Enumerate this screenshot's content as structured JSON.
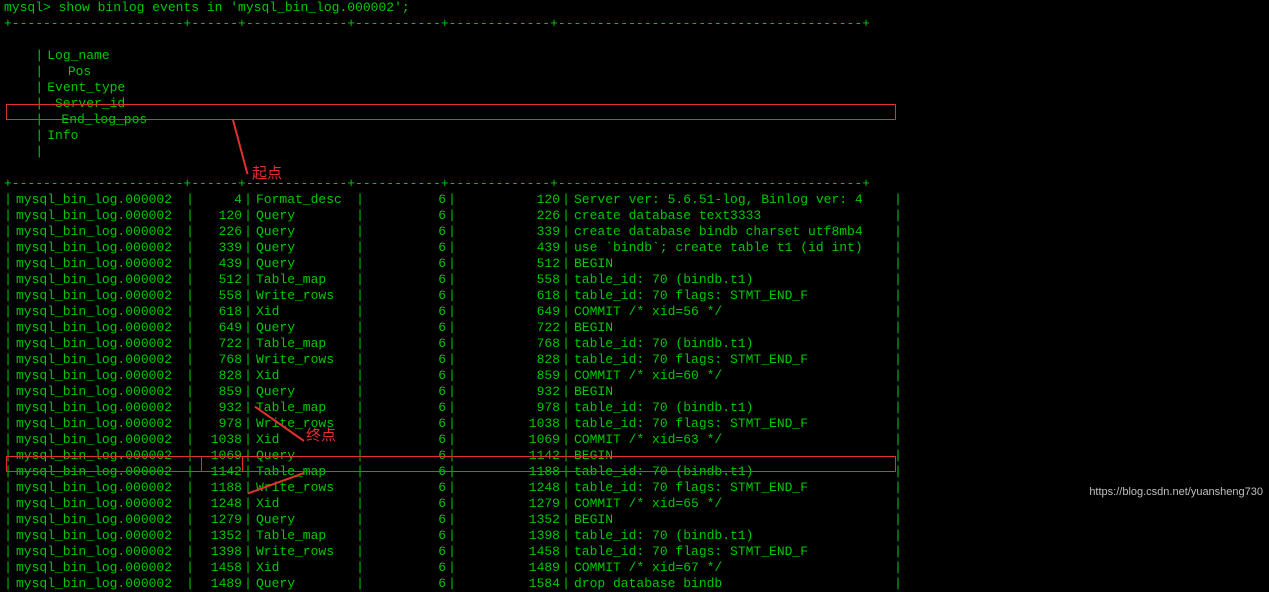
{
  "prompt": "mysql> show binlog events in 'mysql_bin_log.000002';",
  "headers": {
    "log_name": "Log_name",
    "pos": "Pos",
    "event_type": "Event_type",
    "server_id": "Server_id",
    "end_log_pos": "End_log_pos",
    "info": "Info"
  },
  "rows": [
    {
      "log": "mysql_bin_log.000002",
      "pos": "4",
      "evt": "Format_desc",
      "srv": "6",
      "end": "120",
      "info": "Server ver: 5.6.51-log, Binlog ver: 4"
    },
    {
      "log": "mysql_bin_log.000002",
      "pos": "120",
      "evt": "Query",
      "srv": "6",
      "end": "226",
      "info": "create database text3333"
    },
    {
      "log": "mysql_bin_log.000002",
      "pos": "226",
      "evt": "Query",
      "srv": "6",
      "end": "339",
      "info": "create database bindb charset utf8mb4"
    },
    {
      "log": "mysql_bin_log.000002",
      "pos": "339",
      "evt": "Query",
      "srv": "6",
      "end": "439",
      "info": "use `bindb`; create table t1 (id int)"
    },
    {
      "log": "mysql_bin_log.000002",
      "pos": "439",
      "evt": "Query",
      "srv": "6",
      "end": "512",
      "info": "BEGIN"
    },
    {
      "log": "mysql_bin_log.000002",
      "pos": "512",
      "evt": "Table_map",
      "srv": "6",
      "end": "558",
      "info": "table_id: 70 (bindb.t1)"
    },
    {
      "log": "mysql_bin_log.000002",
      "pos": "558",
      "evt": "Write_rows",
      "srv": "6",
      "end": "618",
      "info": "table_id: 70 flags: STMT_END_F"
    },
    {
      "log": "mysql_bin_log.000002",
      "pos": "618",
      "evt": "Xid",
      "srv": "6",
      "end": "649",
      "info": "COMMIT /* xid=56 */"
    },
    {
      "log": "mysql_bin_log.000002",
      "pos": "649",
      "evt": "Query",
      "srv": "6",
      "end": "722",
      "info": "BEGIN"
    },
    {
      "log": "mysql_bin_log.000002",
      "pos": "722",
      "evt": "Table_map",
      "srv": "6",
      "end": "768",
      "info": "table_id: 70 (bindb.t1)"
    },
    {
      "log": "mysql_bin_log.000002",
      "pos": "768",
      "evt": "Write_rows",
      "srv": "6",
      "end": "828",
      "info": "table_id: 70 flags: STMT_END_F"
    },
    {
      "log": "mysql_bin_log.000002",
      "pos": "828",
      "evt": "Xid",
      "srv": "6",
      "end": "859",
      "info": "COMMIT /* xid=60 */"
    },
    {
      "log": "mysql_bin_log.000002",
      "pos": "859",
      "evt": "Query",
      "srv": "6",
      "end": "932",
      "info": "BEGIN"
    },
    {
      "log": "mysql_bin_log.000002",
      "pos": "932",
      "evt": "Table_map",
      "srv": "6",
      "end": "978",
      "info": "table_id: 70 (bindb.t1)"
    },
    {
      "log": "mysql_bin_log.000002",
      "pos": "978",
      "evt": "Write_rows",
      "srv": "6",
      "end": "1038",
      "info": "table_id: 70 flags: STMT_END_F"
    },
    {
      "log": "mysql_bin_log.000002",
      "pos": "1038",
      "evt": "Xid",
      "srv": "6",
      "end": "1069",
      "info": "COMMIT /* xid=63 */"
    },
    {
      "log": "mysql_bin_log.000002",
      "pos": "1069",
      "evt": "Query",
      "srv": "6",
      "end": "1142",
      "info": "BEGIN"
    },
    {
      "log": "mysql_bin_log.000002",
      "pos": "1142",
      "evt": "Table_map",
      "srv": "6",
      "end": "1188",
      "info": "table_id: 70 (bindb.t1)"
    },
    {
      "log": "mysql_bin_log.000002",
      "pos": "1188",
      "evt": "Write_rows",
      "srv": "6",
      "end": "1248",
      "info": "table_id: 70 flags: STMT_END_F"
    },
    {
      "log": "mysql_bin_log.000002",
      "pos": "1248",
      "evt": "Xid",
      "srv": "6",
      "end": "1279",
      "info": "COMMIT /* xid=65 */"
    },
    {
      "log": "mysql_bin_log.000002",
      "pos": "1279",
      "evt": "Query",
      "srv": "6",
      "end": "1352",
      "info": "BEGIN"
    },
    {
      "log": "mysql_bin_log.000002",
      "pos": "1352",
      "evt": "Table_map",
      "srv": "6",
      "end": "1398",
      "info": "table_id: 70 (bindb.t1)"
    },
    {
      "log": "mysql_bin_log.000002",
      "pos": "1398",
      "evt": "Write_rows",
      "srv": "6",
      "end": "1458",
      "info": "table_id: 70 flags: STMT_END_F"
    },
    {
      "log": "mysql_bin_log.000002",
      "pos": "1458",
      "evt": "Xid",
      "srv": "6",
      "end": "1489",
      "info": "COMMIT /* xid=67 */"
    },
    {
      "log": "mysql_bin_log.000002",
      "pos": "1489",
      "evt": "Query",
      "srv": "6",
      "end": "1584",
      "info": "drop database bindb"
    }
  ],
  "annotations": {
    "start_label": "起点",
    "end_label": "终点"
  },
  "watermark": "https://blog.csdn.net/yuansheng730",
  "separator": "+----------------------+------+-------------+-----------+-------------+---------------------------------------+"
}
